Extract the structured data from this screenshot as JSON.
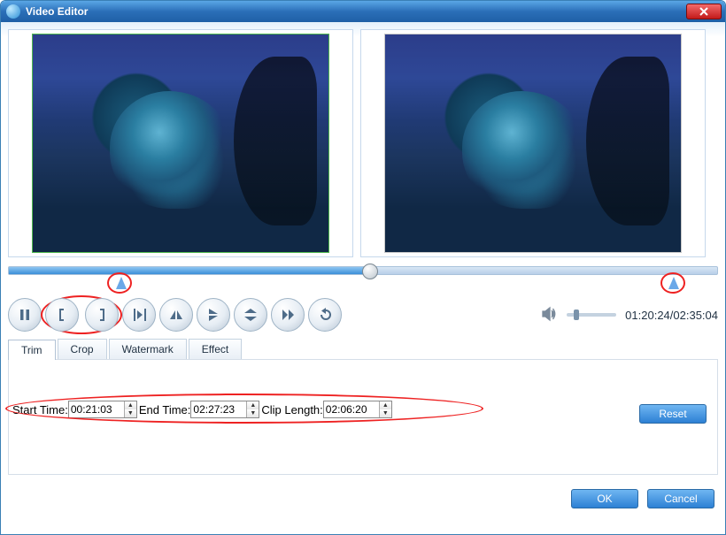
{
  "window": {
    "title": "Video Editor"
  },
  "playback": {
    "current_time": "01:20:24",
    "total_time": "02:35:04",
    "readout": "01:20:24/02:35:04",
    "playhead_pct": 51
  },
  "tabs": {
    "items": [
      {
        "label": "Trim",
        "active": true
      },
      {
        "label": "Crop",
        "active": false
      },
      {
        "label": "Watermark",
        "active": false
      },
      {
        "label": "Effect",
        "active": false
      }
    ]
  },
  "trim": {
    "start_label": "Start Time:",
    "end_label": "End Time:",
    "clip_label": "Clip Length:",
    "start_time": "00:21:03",
    "end_time": "02:27:23",
    "clip_length": "02:06:20"
  },
  "buttons": {
    "reset": "Reset",
    "ok": "OK",
    "cancel": "Cancel"
  },
  "volume": {
    "level_pct": 15
  }
}
